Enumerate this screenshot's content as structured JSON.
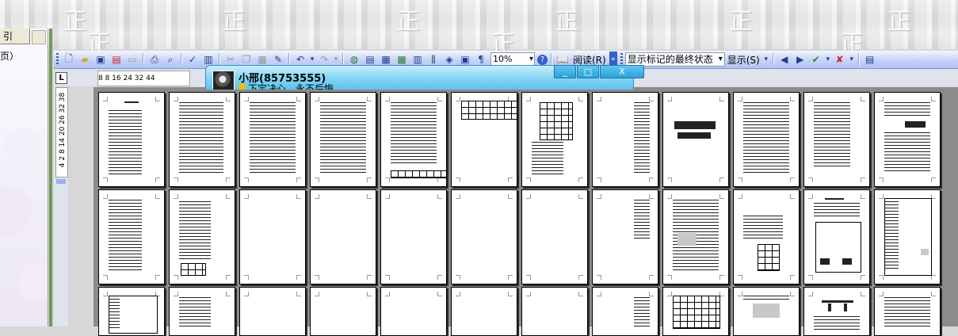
{
  "background": {
    "watermark_glyph": "正"
  },
  "left_panel": {
    "tab_label": "引",
    "text": "页）"
  },
  "toolbar": {
    "zoom_value": "10%",
    "read_label": "阅读(R)",
    "markup_view": "显示标记的最终状态",
    "show_label": "显示(S)"
  },
  "ruler": {
    "corner_label": "L",
    "horizontal_ticks": "8  8  16 24 32 44",
    "vertical_ticks": "4 2 8 14 20 26 32 38"
  },
  "chat": {
    "name": "小邢(85753555)",
    "signature": "下定决心，永不后悔",
    "minimize_label": "_",
    "maximize_label": "□",
    "close_label": "X"
  }
}
